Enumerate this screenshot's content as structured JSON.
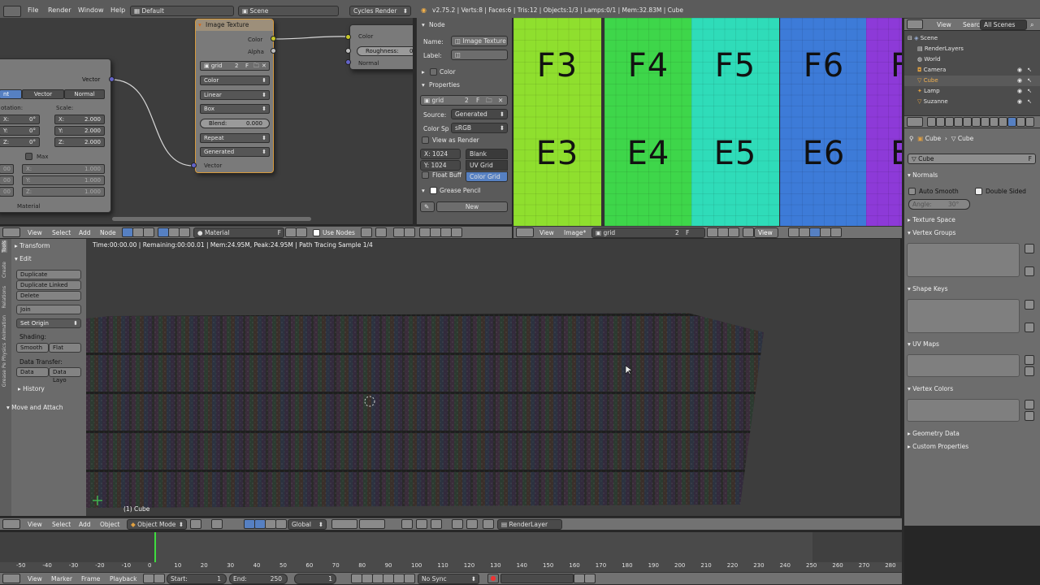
{
  "topbar": {
    "menus": [
      "File",
      "Render",
      "Window",
      "Help"
    ],
    "layout": "Default",
    "scene": "Scene",
    "engine": "Cycles Render",
    "stats": "v2.75.2 | Verts:8 | Faces:6 | Tris:12 | Objects:1/3 | Lamps:0/1 | Mem:32.83M | Cube"
  },
  "node_editor": {
    "left_node": {
      "tabs": [
        "nt",
        "Vector",
        "Normal"
      ],
      "output": "Vector",
      "rotation_label": "otation:",
      "scale_label": "Scale:",
      "rot": [
        "X:",
        "Y:",
        "Z:"
      ],
      "rot_vals": [
        "0°",
        "0°",
        "0°"
      ],
      "scale": [
        "X:",
        "Y:",
        "Z:"
      ],
      "scale_vals": [
        "2.000",
        "2.000",
        "2.000"
      ],
      "max": "Max",
      "minvals": [
        "00",
        "00",
        "00"
      ],
      "maxlabels": [
        "X:",
        "Y:",
        "Z:"
      ],
      "maxvals": [
        "1.000",
        "1.000",
        "1.000"
      ],
      "footer": "Material"
    },
    "image_node": {
      "title": "Image Texture",
      "out_color": "Color",
      "out_alpha": "Alpha",
      "image": "grid",
      "users": "2",
      "fake": "F",
      "color": "Color",
      "interp": "Linear",
      "proj": "Box",
      "blend_label": "Blend:",
      "blend_val": "0.000",
      "ext": "Repeat",
      "source": "Generated",
      "input": "Vector"
    },
    "right_node": {
      "color": "Color",
      "roughness": "Roughness:",
      "rough_val": "0",
      "normal": "Normal"
    },
    "header": {
      "menus": [
        "View",
        "Select",
        "Add",
        "Node"
      ],
      "material": "Material",
      "fake": "F",
      "use_nodes": "Use Nodes"
    }
  },
  "node_props": {
    "node_section": "Node",
    "name_label": "Name:",
    "name_val": "Image Texture",
    "label_label": "Label:",
    "color_section": "Color",
    "properties_section": "Properties",
    "image": "grid",
    "users": "2",
    "fake": "F",
    "source_label": "Source:",
    "source_val": "Generated",
    "colorsp_label": "Color Sp",
    "colorsp_val": "sRGB",
    "view_as_render": "View as Render",
    "x": "X:  1024",
    "y": "Y:  1024",
    "float_buff": "Float Buff",
    "types": [
      "Blank",
      "UV Grid",
      "Color Grid"
    ],
    "grease_pencil": "Grease Pencil",
    "new": "New"
  },
  "image_editor": {
    "top_labels": [
      "F3",
      "F4",
      "F5",
      "F6",
      "F"
    ],
    "bottom_labels": [
      "E3",
      "E4",
      "E5",
      "E6",
      "E"
    ],
    "colors": [
      "#8fdf2e",
      "#3ed64a",
      "#2fdcb9",
      "#3d7bd8",
      "#8d3ad8"
    ],
    "header": {
      "menus": [
        "View",
        "Image*"
      ],
      "image": "grid",
      "users": "2",
      "fake": "F",
      "view": "View"
    }
  },
  "outliner": {
    "menus": [
      "View",
      "Search"
    ],
    "scope": "All Scenes",
    "items": [
      "Scene",
      "RenderLayers",
      "World",
      "Camera",
      "Cube",
      "Lamp",
      "Suzanne"
    ]
  },
  "properties": {
    "crumbs": [
      "Cube",
      "Cube"
    ],
    "mesh_name": "Cube",
    "fake": "F",
    "normals": "Normals",
    "auto_smooth": "Auto Smooth",
    "double_sided": "Double Sided",
    "angle": "Angle:",
    "angle_val": "30°",
    "sections": [
      "Texture Space",
      "Vertex Groups",
      "Shape Keys",
      "UV Maps",
      "Vertex Colors",
      "Geometry Data",
      "Custom Properties"
    ]
  },
  "viewport": {
    "status": "Time:00:00.00 | Remaining:00:00.01 | Mem:24.95M, Peak:24.95M | Path Tracing Sample 1/4",
    "object_label": "(1) Cube",
    "header": {
      "menus": [
        "View",
        "Select",
        "Add",
        "Object"
      ],
      "mode": "Object Mode",
      "orientation": "Global",
      "layer": "RenderLayer"
    }
  },
  "toolshelf": {
    "tabs": [
      "Tools",
      "Create",
      "Relations",
      "Animation",
      "Physics",
      "Grease Pe"
    ],
    "transform": "Transform",
    "edit": "Edit",
    "buttons": [
      "Duplicate",
      "Duplicate Linked",
      "Delete",
      "Join"
    ],
    "set_origin": "Set Origin",
    "shading": "Shading:",
    "smooth": "Smooth",
    "flat": "Flat",
    "data_transfer": "Data Transfer:",
    "data": "Data",
    "data_layo": "Data Layo",
    "history": "History",
    "move_attach": "Move and Attach"
  },
  "timeline": {
    "ticks": [
      "-50",
      "-40",
      "-30",
      "-20",
      "-10",
      "0",
      "10",
      "20",
      "30",
      "40",
      "50",
      "60",
      "70",
      "80",
      "90",
      "100",
      "110",
      "120",
      "130",
      "140",
      "150",
      "160",
      "170",
      "180",
      "190",
      "200",
      "210",
      "220",
      "230",
      "240",
      "250",
      "260",
      "270",
      "280"
    ],
    "current_frame_marker": "0",
    "menus": [
      "View",
      "Marker",
      "Frame",
      "Playback"
    ],
    "start": "Start:",
    "start_val": "1",
    "end": "End:",
    "end_val": "250",
    "current": "1",
    "sync": "No Sync"
  }
}
